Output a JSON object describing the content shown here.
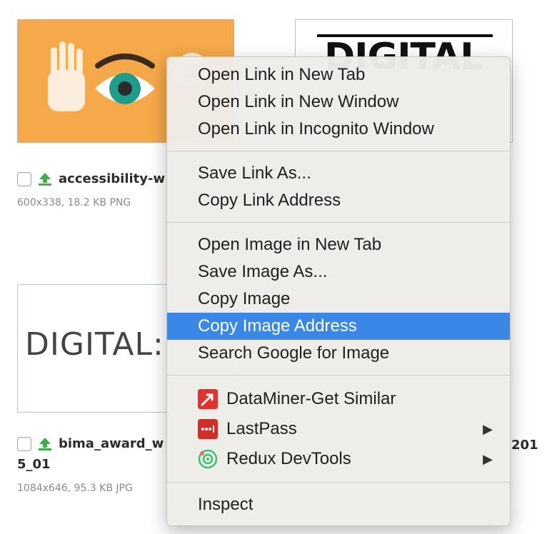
{
  "thumbnails": [
    {
      "id": "accessibility",
      "text": ""
    },
    {
      "id": "digital-black",
      "text": "DIGITAL"
    },
    {
      "id": "digital-grey",
      "text": "DIGITAL:"
    }
  ],
  "files": [
    {
      "name": "accessibility-w",
      "meta": "600x338, 18.2 KB PNG"
    },
    {
      "name": "bima_award_w",
      "name_suffix": "201",
      "name_line2": "5_01",
      "meta": "1084x646, 95.3 KB JPG"
    }
  ],
  "context_menu": {
    "group1": [
      "Open Link in New Tab",
      "Open Link in New Window",
      "Open Link in Incognito Window"
    ],
    "group2": [
      "Save Link As...",
      "Copy Link Address"
    ],
    "group3": [
      "Open Image in New Tab",
      "Save Image As...",
      "Copy Image",
      "Copy Image Address",
      "Search Google for Image"
    ],
    "highlighted": "Copy Image Address",
    "extensions": [
      {
        "label": "DataMiner-Get Similar",
        "icon": "dataminer-icon",
        "color": "#e2322b",
        "has_submenu": false
      },
      {
        "label": "LastPass",
        "icon": "lastpass-icon",
        "color": "#d32d27",
        "has_submenu": true
      },
      {
        "label": "Redux DevTools",
        "icon": "redux-devtools-icon",
        "color": "#39c172",
        "has_submenu": true
      }
    ],
    "inspect": "Inspect",
    "submenu_arrow": "▶"
  },
  "colors": {
    "highlight": "#3b87e6",
    "thumb_orange": "#f5a94a"
  }
}
